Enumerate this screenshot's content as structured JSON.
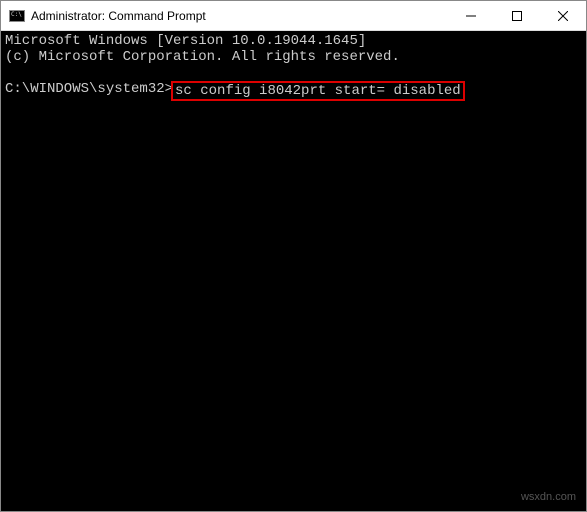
{
  "titlebar": {
    "title": "Administrator: Command Prompt"
  },
  "console": {
    "line1": "Microsoft Windows [Version 10.0.19044.1645]",
    "line2": "(c) Microsoft Corporation. All rights reserved.",
    "prompt": "C:\\WINDOWS\\system32>",
    "command": "sc config i8042prt start= disabled"
  },
  "watermark": "wsxdn.com"
}
